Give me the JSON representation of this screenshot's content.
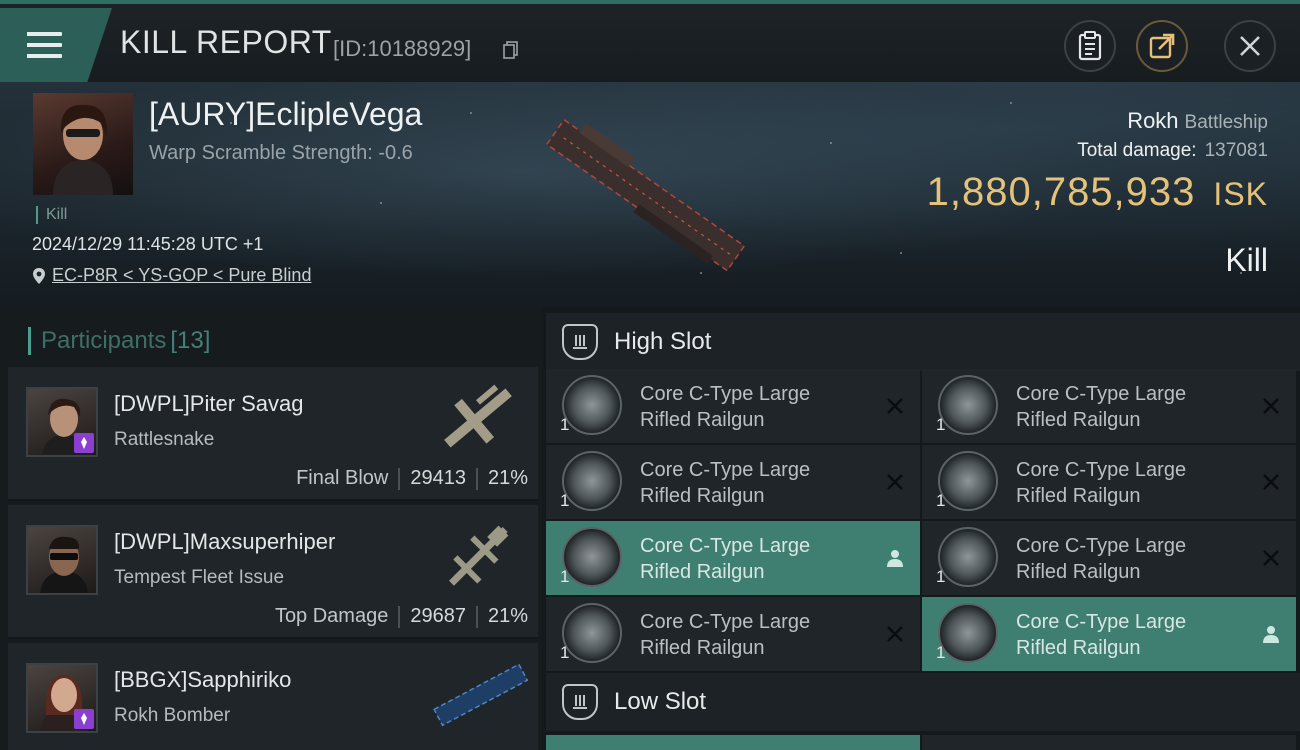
{
  "header": {
    "title": "KILL REPORT",
    "report_id": "[ID:10188929]",
    "icons": [
      "menu-icon",
      "copy-icon",
      "clipboard-icon",
      "share-icon",
      "close-icon"
    ]
  },
  "victim": {
    "name": "[AURY]EclipleVega",
    "warp_scramble": "Warp Scramble Strength: -0.6",
    "kill_tag": "Kill",
    "datetime": "2024/12/29 11:45:28 UTC +1",
    "location": "EC-P8R < YS-GOP < Pure Blind",
    "ship": "Rokh",
    "ship_class": "Battleship",
    "total_damage_label": "Total damage:",
    "total_damage": "137081",
    "isk_value": "1,880,785,933",
    "isk_unit": "ISK",
    "result": "Kill"
  },
  "participants": {
    "title": "Participants",
    "count": "[13]",
    "rows": [
      {
        "name": "[DWPL]Piter Savag",
        "ship": "Rattlesnake",
        "label": "Final Blow",
        "damage": "29413",
        "percent": "21%"
      },
      {
        "name": "[DWPL]Maxsuperhiper",
        "ship": "Tempest Fleet Issue",
        "label": "Top Damage",
        "damage": "29687",
        "percent": "21%"
      },
      {
        "name": "[BBGX]Sapphiriko",
        "ship": "Rokh Bomber",
        "label": "",
        "damage": "",
        "percent": ""
      }
    ]
  },
  "slots": {
    "high_label": "High Slot",
    "low_label": "Low Slot",
    "high_modules": [
      {
        "name": "Core C-Type Large Rifled Railgun",
        "qty": "1",
        "status": "destroyed"
      },
      {
        "name": "Core C-Type Large Rifled Railgun",
        "qty": "1",
        "status": "destroyed"
      },
      {
        "name": "Core C-Type Large Rifled Railgun",
        "qty": "1",
        "status": "destroyed"
      },
      {
        "name": "Core C-Type Large Rifled Railgun",
        "qty": "1",
        "status": "destroyed"
      },
      {
        "name": "Core C-Type Large Rifled Railgun",
        "qty": "1",
        "status": "dropped"
      },
      {
        "name": "Core C-Type Large Rifled Railgun",
        "qty": "1",
        "status": "destroyed"
      },
      {
        "name": "Core C-Type Large Rifled Railgun",
        "qty": "1",
        "status": "destroyed"
      },
      {
        "name": "Core C-Type Large Rifled Railgun",
        "qty": "1",
        "status": "dropped"
      }
    ]
  },
  "colors": {
    "accent": "#3f7f72",
    "isk": "#e5c27a",
    "badge": "#8a3fd0"
  }
}
